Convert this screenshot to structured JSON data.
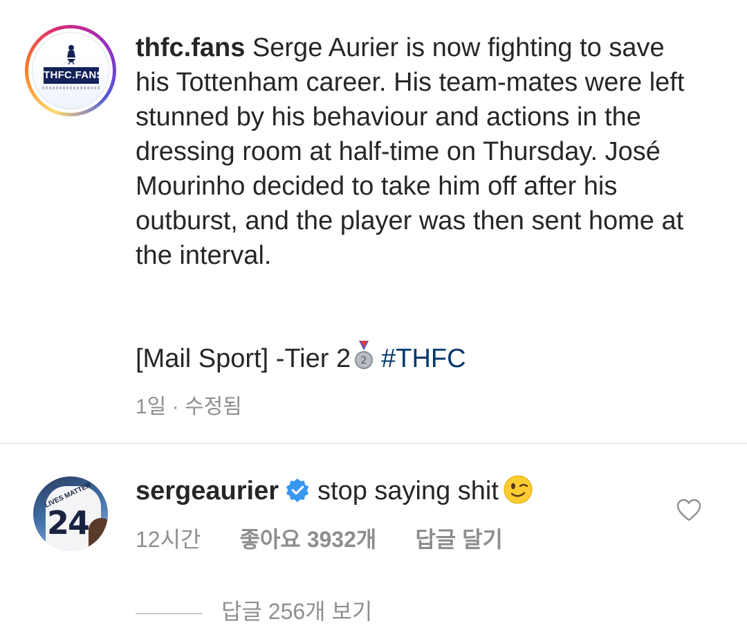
{
  "post": {
    "author": "thfc.fans",
    "avatar_logo_text": "THFC.FANS",
    "caption": "Serge Aurier is now fighting to save his Tottenham career. His team-mates were left stunned by his behaviour and actions in the dressing room at half-time on Thursday. José Mourinho decided to take him off after his outburst, and the player was then sent home at the interval.",
    "source_text": "[Mail Sport] -Tier 2",
    "medal_icon": "second-place-medal",
    "hashtag": "#THFC",
    "time": "1일",
    "separator": "·",
    "edited": "수정됨"
  },
  "comment": {
    "author": "sergeaurier",
    "verified": true,
    "text": "stop saying shit",
    "emoji": "winking-face",
    "time": "12시간",
    "likes": "좋아요 3932개",
    "reply": "답글 달기",
    "view_replies": "답글 256개 보기"
  },
  "colors": {
    "text": "#262626",
    "secondary": "#8e8e8e",
    "hashtag": "#00376b",
    "verified": "#3897f0",
    "divider": "#dbdbdb"
  }
}
